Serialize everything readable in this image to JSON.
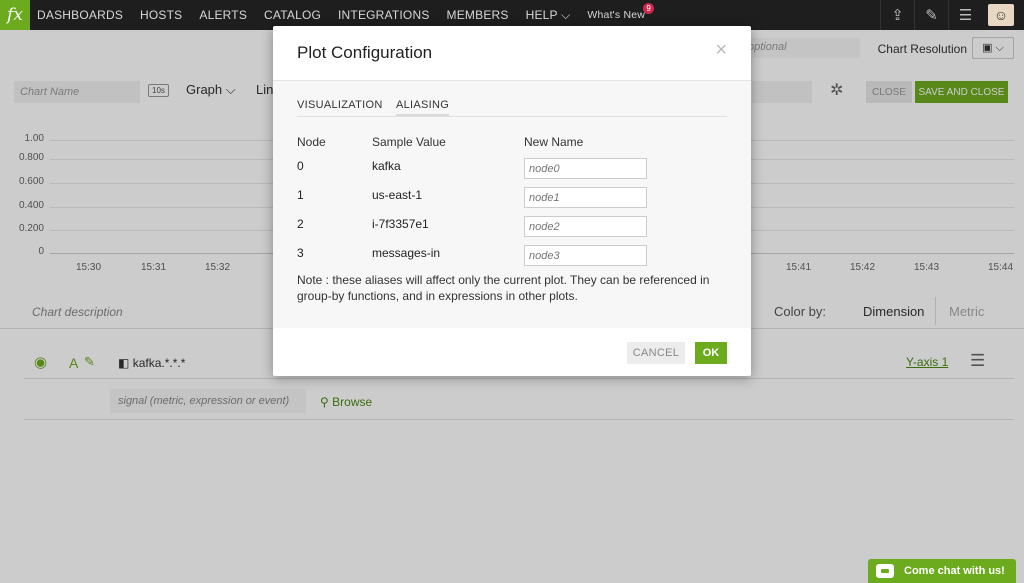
{
  "nav": {
    "logo": "fx",
    "items": [
      "DASHBOARDS",
      "HOSTS",
      "ALERTS",
      "CATALOG",
      "INTEGRATIONS",
      "MEMBERS",
      "HELP ⌵"
    ],
    "whats_new": "What's New",
    "whats_new_badge": "9",
    "accent": "#6dab1e"
  },
  "editor": {
    "optional_placeholder": "optional",
    "chart_resolution_label": "Chart Resolution",
    "chart_name_placeholder": "Chart Name",
    "resolution_tag": "10s",
    "plot_type": "Graph",
    "second_select": "Lin",
    "close_label": "CLOSE",
    "save_close_label": "SAVE AND CLOSE",
    "y_ticks": [
      "1.00",
      "0.800",
      "0.600",
      "0.400",
      "0.200",
      "0"
    ],
    "x_ticks": [
      "15:30",
      "15:31",
      "15:32",
      "15:41",
      "15:42",
      "15:43",
      "15:44"
    ],
    "chart_description_placeholder": "Chart description",
    "color_by_label": "Color by:",
    "dimension_label": "Dimension",
    "metric_label": "Metric",
    "plot_signal": "kafka.*.*.*",
    "y_axis_label": "Y-axis 1",
    "signal_placeholder": "signal (metric, expression or event)",
    "browse_label": "Browse"
  },
  "modal": {
    "title": "Plot Configuration",
    "tabs": [
      "VISUALIZATION",
      "ALIASING"
    ],
    "active_tab": "ALIASING",
    "columns": [
      "Node",
      "Sample Value",
      "New Name"
    ],
    "rows": [
      {
        "node": "0",
        "sample": "kafka",
        "placeholder": "node0"
      },
      {
        "node": "1",
        "sample": "us-east-1",
        "placeholder": "node1"
      },
      {
        "node": "2",
        "sample": "i-7f3357e1",
        "placeholder": "node2"
      },
      {
        "node": "3",
        "sample": "messages-in",
        "placeholder": "node3"
      }
    ],
    "note": "Note : these aliases will affect only the current plot. They can be referenced in group-by functions, and in expressions in other plots.",
    "cancel_label": "CANCEL",
    "ok_label": "OK"
  },
  "chat": {
    "label": "Come chat with us!"
  }
}
